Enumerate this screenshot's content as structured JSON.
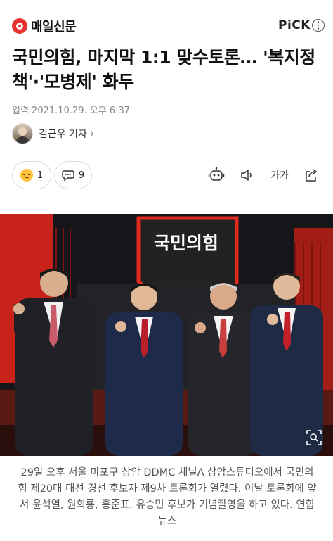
{
  "header": {
    "logo_text": "매일신문",
    "pick_label": "PiCK"
  },
  "article": {
    "headline": "국민의힘, 마지막 1:1 맞수토론… '복지정책'·'모병제' 화두",
    "datetime": "입력 2021.10.29. 오후 6:37",
    "reporter": "김근우 기자",
    "reporter_chevron": "›",
    "reaction_count": "1",
    "comment_count": "9",
    "font_size_label": "가가",
    "photo_sign": "국민의힘",
    "caption": "29일 오후 서울 마포구 상암 DDMC 채널A 상암스튜디오에서 국민의힘 제20대 대선 경선 후보자 제9차 토론회가 열렸다. 이날 토론회에 앞서 윤석열, 원희룡, 홍준표, 유승민 후보가 기념촬영을 하고 있다. 연합뉴스"
  },
  "colors": {
    "brand": "#e8322f",
    "stage_red": "#d9261c"
  },
  "icons": [
    "logo-icon",
    "more-icon",
    "sad-face-icon",
    "comment-icon",
    "tts-robot-icon",
    "speaker-icon",
    "share-icon",
    "zoom-icon"
  ]
}
